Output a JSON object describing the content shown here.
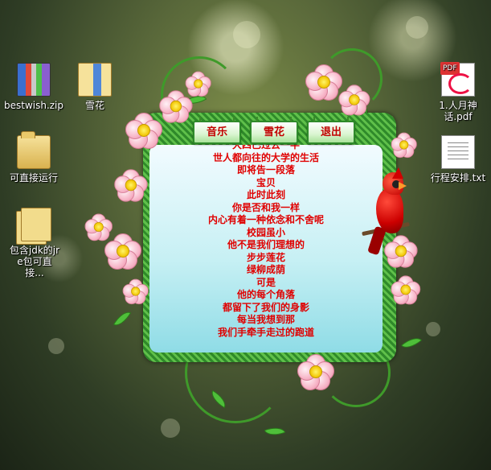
{
  "desktop": {
    "icons": [
      {
        "name": "bestwish.zip",
        "type": "zip"
      },
      {
        "name": "雪花",
        "type": "folder-blue"
      },
      {
        "name": "可直接运行",
        "type": "folder"
      },
      {
        "name": "包含jdk的jre包可直接...",
        "type": "folder-stack"
      },
      {
        "name": "1.人月神话.pdf",
        "type": "pdf"
      },
      {
        "name": "行程安排.txt",
        "type": "txt"
      }
    ]
  },
  "widget": {
    "buttons": {
      "music": "音乐",
      "snow": "雪花",
      "exit": "退出"
    },
    "poem_lines": [
      "大四已过去一半",
      "世人都向往的大学的生活",
      "即将告一段落",
      "宝贝",
      "此时此刻",
      "你是否和我一样",
      "内心有着一种依念和不舍呢",
      "校园虽小",
      "他不是我们理想的",
      "步步莲花",
      "绿柳成荫",
      "可是",
      "他的每个角落",
      "都留下了我们的身影",
      "每当我想到那",
      "我们手牵手走过的跑道"
    ],
    "colors": {
      "poem_text": "#e00000",
      "frame": "#3f9a2a",
      "panel": "#c7f0f4"
    }
  }
}
